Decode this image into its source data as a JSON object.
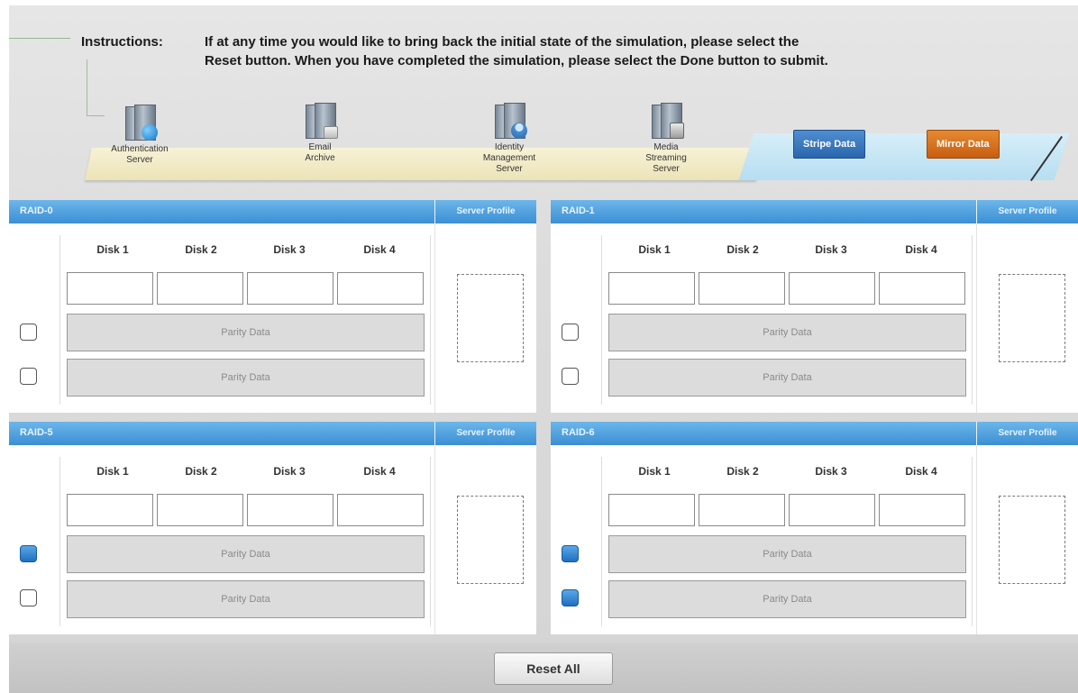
{
  "instructions": {
    "label": "Instructions:",
    "line1": "If at any time you would like to bring back the initial state of the simulation, please select the",
    "line2": "Reset button. When you have completed the simulation, please select the Done button to submit."
  },
  "servers": [
    {
      "name_line1": "Authentication",
      "name_line2": "Server",
      "name_line3": "",
      "icon": "server-globe-icon"
    },
    {
      "name_line1": "Email",
      "name_line2": "Archive",
      "name_line3": "",
      "icon": "server-archive-icon"
    },
    {
      "name_line1": "Identity",
      "name_line2": "Management",
      "name_line3": "Server",
      "icon": "server-user-icon"
    },
    {
      "name_line1": "Media",
      "name_line2": "Streaming",
      "name_line3": "Server",
      "icon": "server-media-icon"
    }
  ],
  "actions": {
    "stripe": "Stripe Data",
    "mirror": "Mirror Data",
    "reset": "Reset All"
  },
  "panels": [
    {
      "title": "RAID-0",
      "profile_label": "Server Profile",
      "disks": [
        "Disk 1",
        "Disk 2",
        "Disk 3",
        "Disk 4"
      ],
      "rows": [
        {
          "label": "Parity Data",
          "checked": false
        },
        {
          "label": "Parity Data",
          "checked": false
        }
      ]
    },
    {
      "title": "RAID-1",
      "profile_label": "Server Profile",
      "disks": [
        "Disk 1",
        "Disk 2",
        "Disk 3",
        "Disk 4"
      ],
      "rows": [
        {
          "label": "Parity Data",
          "checked": false
        },
        {
          "label": "Parity Data",
          "checked": false
        }
      ]
    },
    {
      "title": "RAID-5",
      "profile_label": "Server Profile",
      "disks": [
        "Disk 1",
        "Disk 2",
        "Disk 3",
        "Disk 4"
      ],
      "rows": [
        {
          "label": "Parity Data",
          "checked": true
        },
        {
          "label": "Parity Data",
          "checked": false
        }
      ]
    },
    {
      "title": "RAID-6",
      "profile_label": "Server Profile",
      "disks": [
        "Disk 1",
        "Disk 2",
        "Disk 3",
        "Disk 4"
      ],
      "rows": [
        {
          "label": "Parity Data",
          "checked": true
        },
        {
          "label": "Parity Data",
          "checked": true
        }
      ]
    }
  ],
  "colors": {
    "header_blue": "#3b8fd4",
    "stripe_blue": "#2a66ad",
    "mirror_orange": "#c85e10",
    "checkbox_checked": "#1f6fbf"
  }
}
